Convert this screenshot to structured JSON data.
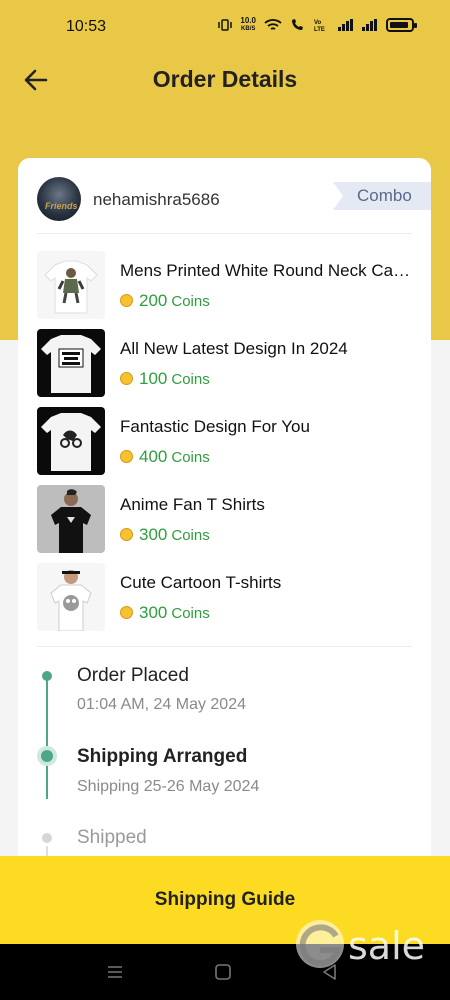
{
  "status_bar": {
    "time": "10:53",
    "network_speed_value": "10.0",
    "network_speed_unit": "KB/S"
  },
  "header": {
    "title": "Order Details"
  },
  "seller": {
    "name": "nehamishra5686",
    "tag": "Combo",
    "avatar_text": "Friends"
  },
  "items": [
    {
      "name": "Mens Printed White Round Neck Casual T-shirt",
      "price": "200",
      "unit": "Coins"
    },
    {
      "name": "All New Latest Design In 2024",
      "price": "100",
      "unit": "Coins"
    },
    {
      "name": "Fantastic Design For You",
      "price": "400",
      "unit": "Coins"
    },
    {
      "name": "Anime Fan T Shirts",
      "price": "300",
      "unit": "Coins"
    },
    {
      "name": "Cute Cartoon T-shirts",
      "price": "300",
      "unit": "Coins"
    }
  ],
  "timeline": [
    {
      "title": "Order Placed",
      "subtitle": "01:04 AM, 24 May 2024",
      "state": "done"
    },
    {
      "title": "Shipping Arranged",
      "subtitle": "Shipping 25-26 May 2024",
      "state": "current"
    },
    {
      "title": "Shipped",
      "subtitle": "",
      "state": "pending"
    }
  ],
  "footer": {
    "button_label": "Shipping Guide"
  },
  "watermark": {
    "text": "sale"
  },
  "icons": [
    "back-arrow-icon",
    "vibrate-icon",
    "wifi-icon",
    "call-icon",
    "volte-icon",
    "signal-icon",
    "battery-icon",
    "coin-icon",
    "menu-nav-icon",
    "home-nav-icon",
    "back-nav-icon"
  ],
  "colors": {
    "header_bg": "#e8c846",
    "button_bg": "#fcdb22",
    "price_green": "#2e9e3e",
    "timeline_green": "#4ea688",
    "tag_bg": "#e4e9f4"
  }
}
